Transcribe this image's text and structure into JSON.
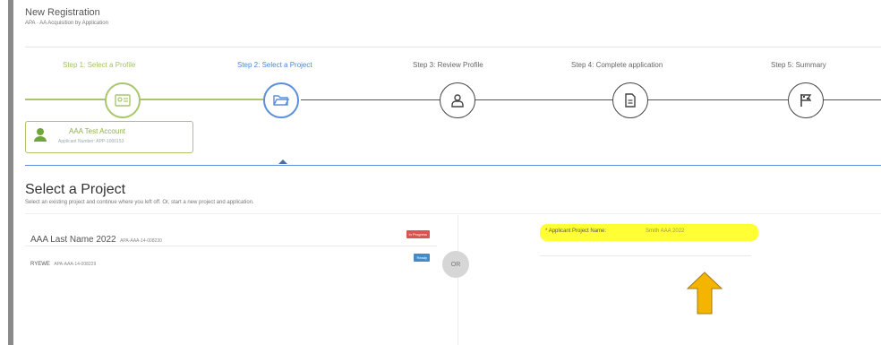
{
  "header": {
    "title": "New Registration",
    "subtitle": "APA · AA Acquisition by Application"
  },
  "steps": [
    {
      "label": "Step 1: Select a Profile",
      "state": "done",
      "icon": "id-card-icon"
    },
    {
      "label": "Step 2: Select a Project",
      "state": "active",
      "icon": "folder-open-icon"
    },
    {
      "label": "Step 3: Review Profile",
      "state": "pending",
      "icon": "user-icon"
    },
    {
      "label": "Step 4: Complete application",
      "state": "pending",
      "icon": "document-icon"
    },
    {
      "label": "Step 5: Summary",
      "state": "pending",
      "icon": "flag-icon"
    }
  ],
  "account": {
    "name": "AAA Test Account",
    "number": "Applicant Number: APP-1000153"
  },
  "section": {
    "title": "Select a Project",
    "description": "Select an existing project and continue where you left off. Or, start a new project and application."
  },
  "projects": [
    {
      "name": "AAA Last Name 2022",
      "id": "APA-AAA-14-008230",
      "badge": "In Progress",
      "badge_color": "#d9534f"
    },
    {
      "name": "RYEWE",
      "id": "APA-AAA-14-008229",
      "badge": "Ready",
      "badge_color": "#428bca"
    }
  ],
  "or_label": "OR",
  "new_project": {
    "required_mark": "*",
    "label": "Applicant Project Name:",
    "value": "Smith AAA 2022"
  },
  "colors": {
    "done": "#a9c66e",
    "active": "#5b8fd9",
    "highlight": "#ffff33",
    "arrow": "#f5b400"
  }
}
